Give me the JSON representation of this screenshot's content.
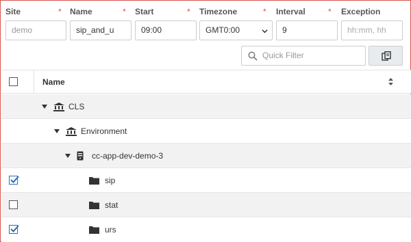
{
  "form": {
    "site": {
      "label": "Site",
      "required": "*",
      "value": "demo"
    },
    "name": {
      "label": "Name",
      "required": "*",
      "value": "sip_and_u"
    },
    "start": {
      "label": "Start",
      "required": "*",
      "value": "09:00"
    },
    "timezone": {
      "label": "Timezone",
      "required": "*",
      "value": "GMT0:00"
    },
    "interval": {
      "label": "Interval",
      "required": "*",
      "value": "9"
    },
    "exception": {
      "label": "Exception",
      "placeholder": "hh:mm, hh"
    }
  },
  "toolbar": {
    "quick_filter_placeholder": "Quick Filter",
    "copy_icon": "copy-icon",
    "search_icon": "search-icon"
  },
  "grid": {
    "header": {
      "name": "Name"
    },
    "rows": [
      {
        "label": "CLS",
        "icon": "bank-icon",
        "expanded": true,
        "checkbox": false,
        "checked": false
      },
      {
        "label": "Environment",
        "icon": "bank-icon",
        "expanded": true,
        "checkbox": false,
        "checked": false
      },
      {
        "label": "cc-app-dev-demo-3",
        "icon": "server-icon",
        "expanded": true,
        "checkbox": false,
        "checked": false
      },
      {
        "label": "sip",
        "icon": "folder-icon",
        "checkbox": true,
        "checked": true
      },
      {
        "label": "stat",
        "icon": "folder-icon",
        "checkbox": true,
        "checked": false
      },
      {
        "label": "urs",
        "icon": "folder-icon",
        "checkbox": true,
        "checked": true
      }
    ]
  },
  "colors": {
    "required": "#d9534f",
    "check": "#2a6db6",
    "row_shade": "#f2f2f2"
  }
}
